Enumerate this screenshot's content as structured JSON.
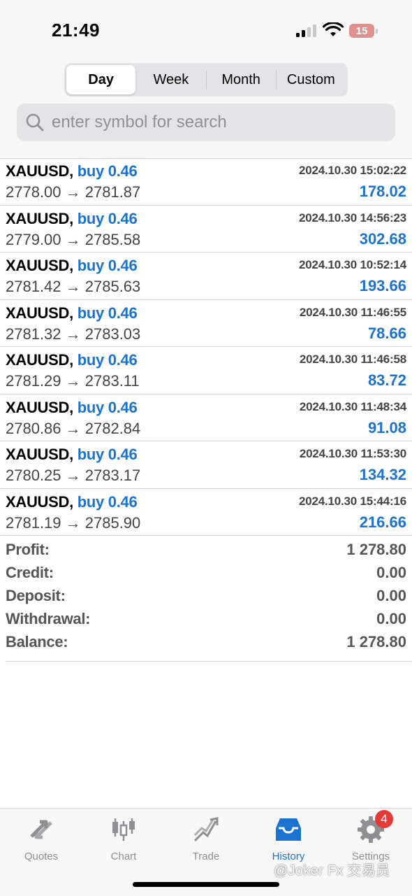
{
  "status": {
    "time": "21:49",
    "battery": "15"
  },
  "segments": [
    {
      "label": "Day",
      "active": true
    },
    {
      "label": "Week",
      "active": false
    },
    {
      "label": "Month",
      "active": false
    },
    {
      "label": "Custom",
      "active": false
    }
  ],
  "search": {
    "placeholder": "enter symbol for search"
  },
  "deals": [
    {
      "symbol": "XAUUSD,",
      "side": "buy 0.46",
      "time": "2024.10.30 15:02:22",
      "prices": "2778.00 → 2781.87",
      "profit": "178.02"
    },
    {
      "symbol": "XAUUSD,",
      "side": "buy 0.46",
      "time": "2024.10.30 14:56:23",
      "prices": "2779.00 → 2785.58",
      "profit": "302.68"
    },
    {
      "symbol": "XAUUSD,",
      "side": "buy 0.46",
      "time": "2024.10.30 10:52:14",
      "prices": "2781.42 → 2785.63",
      "profit": "193.66"
    },
    {
      "symbol": "XAUUSD,",
      "side": "buy 0.46",
      "time": "2024.10.30 11:46:55",
      "prices": "2781.32 → 2783.03",
      "profit": "78.66"
    },
    {
      "symbol": "XAUUSD,",
      "side": "buy 0.46",
      "time": "2024.10.30 11:46:58",
      "prices": "2781.29 → 2783.11",
      "profit": "83.72"
    },
    {
      "symbol": "XAUUSD,",
      "side": "buy 0.46",
      "time": "2024.10.30 11:48:34",
      "prices": "2780.86 → 2782.84",
      "profit": "91.08"
    },
    {
      "symbol": "XAUUSD,",
      "side": "buy 0.46",
      "time": "2024.10.30 11:53:30",
      "prices": "2780.25 → 2783.17",
      "profit": "134.32"
    },
    {
      "symbol": "XAUUSD,",
      "side": "buy 0.46",
      "time": "2024.10.30 15:44:16",
      "prices": "2781.19 → 2785.90",
      "profit": "216.66"
    }
  ],
  "summary": [
    {
      "label": "Profit:",
      "value": "1 278.80"
    },
    {
      "label": "Credit:",
      "value": "0.00"
    },
    {
      "label": "Deposit:",
      "value": "0.00"
    },
    {
      "label": "Withdrawal:",
      "value": "0.00"
    },
    {
      "label": "Balance:",
      "value": "1 278.80"
    }
  ],
  "tabs": [
    {
      "label": "Quotes",
      "icon": "quotes-icon",
      "active": false
    },
    {
      "label": "Chart",
      "icon": "candlestick-icon",
      "active": false
    },
    {
      "label": "Trade",
      "icon": "trade-icon",
      "active": false
    },
    {
      "label": "History",
      "icon": "inbox-icon",
      "active": true
    },
    {
      "label": "Settings",
      "icon": "gear-icon",
      "active": false,
      "badge": "4"
    }
  ],
  "watermark": "@Joker Fx 交易员",
  "colors": {
    "accent": "#1a73d1",
    "badge": "#e53935"
  }
}
